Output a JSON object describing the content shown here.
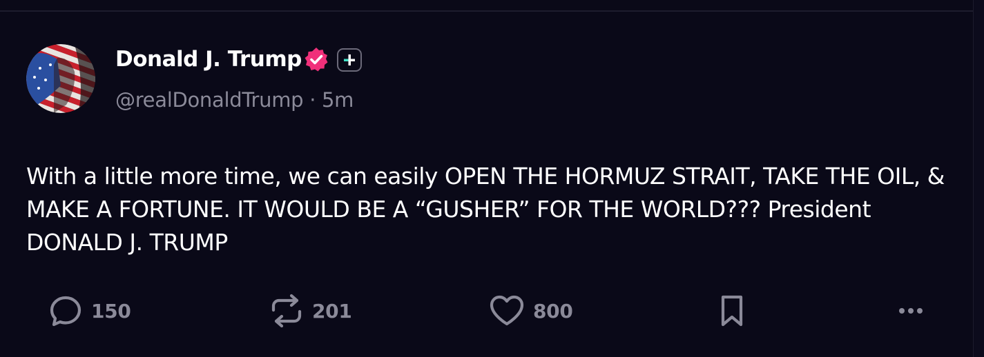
{
  "post": {
    "author": {
      "display_name": "Donald J. Trump",
      "handle": "@realDonaldTrump",
      "separator": "·",
      "time": "5m",
      "avatar_icon": "avatar-flag-portrait",
      "verified_icon": "verified-badge-icon",
      "plus_icon": "plus-badge-icon"
    },
    "text": "With a little more time, we can easily OPEN THE HORMUZ STRAIT, TAKE THE OIL, & MAKE A FORTUNE. IT WOULD BE A “GUSHER” FOR THE WORLD??? President DONALD J. TRUMP",
    "actions": {
      "reply": {
        "icon": "reply-icon",
        "count": "150"
      },
      "repost": {
        "icon": "repost-icon",
        "count": "201"
      },
      "like": {
        "icon": "heart-icon",
        "count": "800"
      },
      "bookmark": {
        "icon": "bookmark-icon"
      },
      "more": {
        "icon": "more-icon"
      }
    }
  },
  "colors": {
    "background": "#0a0918",
    "text": "#ffffff",
    "muted": "#8b8a99",
    "verified": "#f0307a",
    "plus_accent": "#3fe0c5"
  }
}
